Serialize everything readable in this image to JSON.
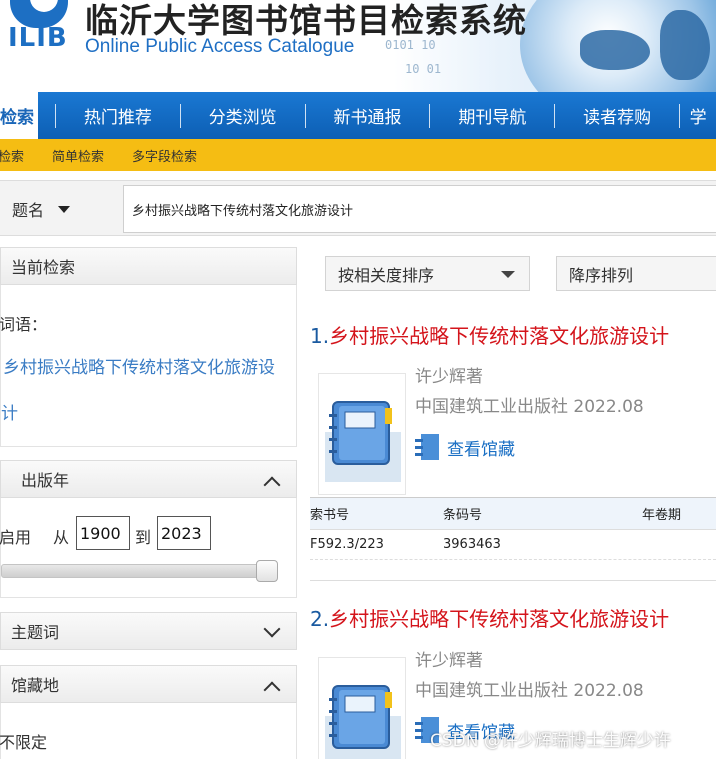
{
  "header": {
    "logo_text": "ILIB",
    "title": "临沂大学图书馆书目检索系统",
    "subtitle": "Online Public Access Catalogue",
    "binary_a": "0101 10",
    "binary_b": "10 01"
  },
  "nav": {
    "items": [
      {
        "label": "检索"
      },
      {
        "label": "热门推荐"
      },
      {
        "label": "分类浏览"
      },
      {
        "label": "新书通报"
      },
      {
        "label": "期刊导航"
      },
      {
        "label": "读者荐购"
      },
      {
        "label": "学"
      }
    ],
    "active_index": 0
  },
  "subnav": {
    "items": [
      {
        "label": "检索"
      },
      {
        "label": "简单检索"
      },
      {
        "label": "多字段检索"
      }
    ]
  },
  "search": {
    "field": "题名",
    "query": "乡村振兴战略下传统村落文化旅游设计"
  },
  "facets": {
    "current": {
      "heading": "当前检索",
      "term_label": "词语：",
      "term_line1": "乡村振兴战略下传统村落文化旅游设",
      "term_line2": "计"
    },
    "year": {
      "heading": "出版年",
      "enable_label": "启用",
      "from_label": "从",
      "from_value": "1900",
      "to_label": "到",
      "to_value": "2023"
    },
    "subject": {
      "heading": "主题词"
    },
    "location": {
      "heading": "馆藏地",
      "first_option": "不限定"
    }
  },
  "sort": {
    "order_by": "按相关度排序",
    "direction": "降序排列"
  },
  "results": [
    {
      "num": "1.",
      "title": "乡村振兴战略下传统村落文化旅游设计",
      "author": "许少辉著",
      "publisher": "中国建筑工业出版社 2022.08",
      "holdings_label": "查看馆藏",
      "table_headers": [
        "索书号",
        "条码号",
        "年卷期"
      ],
      "rows": [
        [
          "F592.3/223",
          "3963463",
          ""
        ]
      ]
    },
    {
      "num": "2.",
      "title": "乡村振兴战略下传统村落文化旅游设计",
      "author": "许少辉著",
      "publisher": "中国建筑工业出版社 2022.08",
      "holdings_label": "查看馆藏"
    }
  ],
  "watermark": "CSDN @许少辉瑞博士生辉少许",
  "colors": {
    "nav_blue": "#1a78d3",
    "subnav_yellow": "#f5bd13",
    "title_red": "#d4141b",
    "link_blue": "#1a6fc4"
  }
}
